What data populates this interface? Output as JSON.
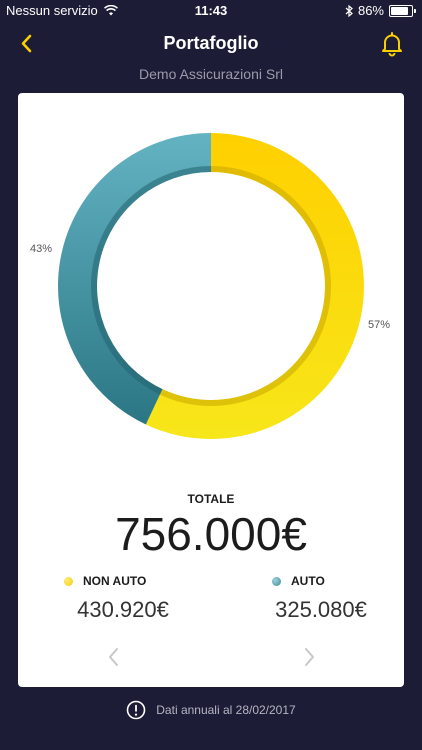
{
  "status_bar": {
    "carrier": "Nessun servizio",
    "time": "11:43",
    "battery_percent": "86%",
    "battery_level": 0.86
  },
  "nav": {
    "title": "Portafoglio",
    "back_icon": "chevron-left-icon",
    "bell_icon": "bell-icon"
  },
  "subtitle": "Demo Assicurazioni Srl",
  "colors": {
    "background": "#1c1c36",
    "accent_yellow": "#f8cf00",
    "accent_teal": "#3a8b99"
  },
  "chart_data": {
    "type": "pie",
    "donut": true,
    "categories": [
      "NON AUTO",
      "AUTO"
    ],
    "values": [
      57,
      43
    ],
    "labels": [
      "57%",
      "43%"
    ],
    "colors": [
      "#f8cf00",
      "#3a8b99"
    ]
  },
  "summary": {
    "total_label": "TOTALE",
    "total_value": "756.000€",
    "non_auto_label": "NON AUTO",
    "non_auto_value": "430.920€",
    "auto_label": "AUTO",
    "auto_value": "325.080€"
  },
  "footer": {
    "info_icon": "exclamation-circle-icon",
    "text": "Dati annuali al 28/02/2017"
  }
}
